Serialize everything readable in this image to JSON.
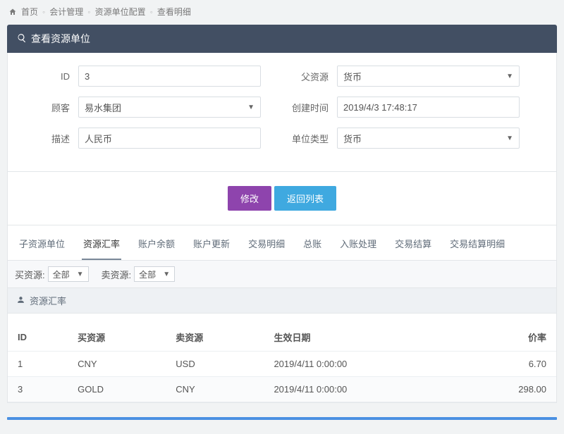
{
  "breadcrumb": {
    "home": "首页",
    "seg1": "会计管理",
    "seg2": "资源单位配置",
    "seg3": "查看明细"
  },
  "panel": {
    "title": "查看资源单位"
  },
  "form": {
    "id_label": "ID",
    "id_value": "3",
    "parent_label": "父资源",
    "parent_value": "货币",
    "customer_label": "顾客",
    "customer_value": "易水集团",
    "created_label": "创建时间",
    "created_value": "2019/4/3 17:48:17",
    "desc_label": "描述",
    "desc_value": "人民币",
    "unit_type_label": "单位类型",
    "unit_type_value": "货币"
  },
  "buttons": {
    "edit": "修改",
    "back": "返回列表"
  },
  "tabs": {
    "items": [
      "子资源单位",
      "资源汇率",
      "账户余额",
      "账户更新",
      "交易明细",
      "总账",
      "入账处理",
      "交易结算",
      "交易结算明细"
    ],
    "active_index": 1
  },
  "filters": {
    "buy_label": "买资源:",
    "buy_value": "全部",
    "sell_label": "卖资源:",
    "sell_value": "全部"
  },
  "sub_header": {
    "title": "资源汇率"
  },
  "table": {
    "columns": [
      "ID",
      "买资源",
      "卖资源",
      "生效日期",
      "价率"
    ],
    "rows": [
      {
        "id": "1",
        "buy": "CNY",
        "sell": "USD",
        "date": "2019/4/11 0:00:00",
        "rate": "6.70"
      },
      {
        "id": "3",
        "buy": "GOLD",
        "sell": "CNY",
        "date": "2019/4/11 0:00:00",
        "rate": "298.00"
      }
    ]
  }
}
